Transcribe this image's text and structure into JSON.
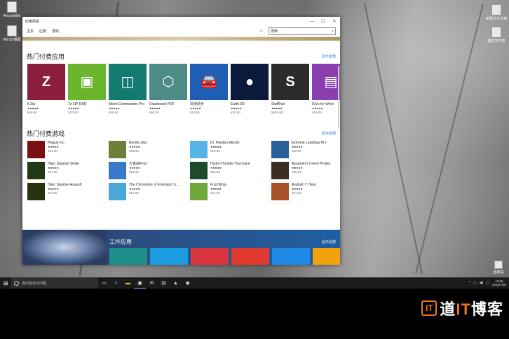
{
  "window": {
    "title": "应用商店",
    "controls": [
      "—",
      "☐",
      "✕"
    ],
    "nav": [
      "主页",
      "应用",
      "游戏"
    ],
    "search_text": "搜索"
  },
  "paid_apps": {
    "title": "热门付费应用",
    "show_all": "显示全部",
    "items": [
      {
        "name": "8 Zip",
        "rating": "★★★★★",
        "price": "¥49.50",
        "color": "#8b1e3f",
        "glyph": "Z"
      },
      {
        "name": "7z ZIP RAR",
        "rating": "★★★★★",
        "price": "¥37.50",
        "color": "#6ab52c",
        "glyph": "▣"
      },
      {
        "name": "Metro Commander Pro",
        "rating": "★★★★★",
        "price": "¥49.50",
        "color": "#137a6f",
        "glyph": "◫"
      },
      {
        "name": "Drawboard PDF",
        "rating": "★★★★★",
        "price": "¥62.00",
        "color": "#4c8b86",
        "glyph": "⬡"
      },
      {
        "name": "驾考助手",
        "rating": "★★★★★",
        "price": "¥12.50",
        "color": "#1e5fb5",
        "glyph": "🚘"
      },
      {
        "name": "Earth 3D",
        "rating": "★★★★★",
        "price": "¥18.50",
        "color": "#0b1a3a",
        "glyph": "●"
      },
      {
        "name": "StaffPad",
        "rating": "★★★★★",
        "price": "¥425.50",
        "color": "#2b2b2b",
        "glyph": "S"
      },
      {
        "name": "DjVu for Wind",
        "rating": "★★★★★",
        "price": "¥25.00",
        "color": "#8a3fb0",
        "glyph": "▤"
      }
    ]
  },
  "paid_games": {
    "title": "热门付费游戏",
    "show_all": "显示全部",
    "items": [
      {
        "name": "Plague Inc.",
        "rating": "★★★★★",
        "price": "¥12.50",
        "color": "#7a0f12"
      },
      {
        "name": "Halo: Spartan Strike",
        "rating": "★★★★★",
        "price": "¥37.50",
        "color": "#1f3b16"
      },
      {
        "name": "Halo: Spartan Assault",
        "rating": "★★★★★",
        "price": "¥31.00",
        "color": "#26330f"
      },
      {
        "name": "illomilo plus",
        "rating": "★★★★★",
        "price": "¥31.00",
        "color": "#6f7f3a"
      },
      {
        "name": "大富翁4 fun",
        "rating": "★★★★★",
        "price": "¥21.50",
        "color": "#3a78c8"
      },
      {
        "name": "The Chronicles of Emerland S...",
        "rating": "★★★★★",
        "price": "¥12.50",
        "color": "#4aa9d6"
      },
      {
        "name": "Dr. Panda's Airport",
        "rating": "★★★★★",
        "price": "¥18.50",
        "color": "#58b4e6"
      },
      {
        "name": "Hydro-Thunder Hurricane",
        "rating": "★★★★★",
        "price": "¥62.00",
        "color": "#1d4a2a"
      },
      {
        "name": "Fruit Ninja",
        "rating": "★★★★★",
        "price": "¥12.50",
        "color": "#6fa83a"
      },
      {
        "name": "Extreme Landings Pro",
        "rating": "★★★★★",
        "price": "¥62.00",
        "color": "#2a5f9a"
      },
      {
        "name": "Assassin's Creed Pirates",
        "rating": "★★★★★",
        "price": "¥26.00",
        "color": "#3b2e22"
      },
      {
        "name": "Asphalt 7: Heat",
        "rating": "★★★★★",
        "price": "¥31.00",
        "color": "#a8522a"
      }
    ]
  },
  "work_apps": {
    "title": "工作应用",
    "show_all": "显示全部",
    "tiles": [
      "#1f8f8a",
      "#1b9be0",
      "#d9363e",
      "#e03a2f",
      "#1e88e5",
      "#f2a20c"
    ]
  },
  "taskbar": {
    "search_placeholder": "询问我任何问题",
    "start_glyph": "⊞",
    "clock_time": "10:06",
    "clock_date": "2015/7/30"
  },
  "desktop_icons": [
    {
      "label": "RecycleBin"
    },
    {
      "label": "Win10 截图"
    },
    {
      "label": "新建文本文档"
    },
    {
      "label": "临时文件夹"
    },
    {
      "label": "回收站"
    }
  ],
  "watermark": {
    "logo": "IT",
    "text_a": "道",
    "text_b": "IT",
    "text_c": "博客"
  }
}
